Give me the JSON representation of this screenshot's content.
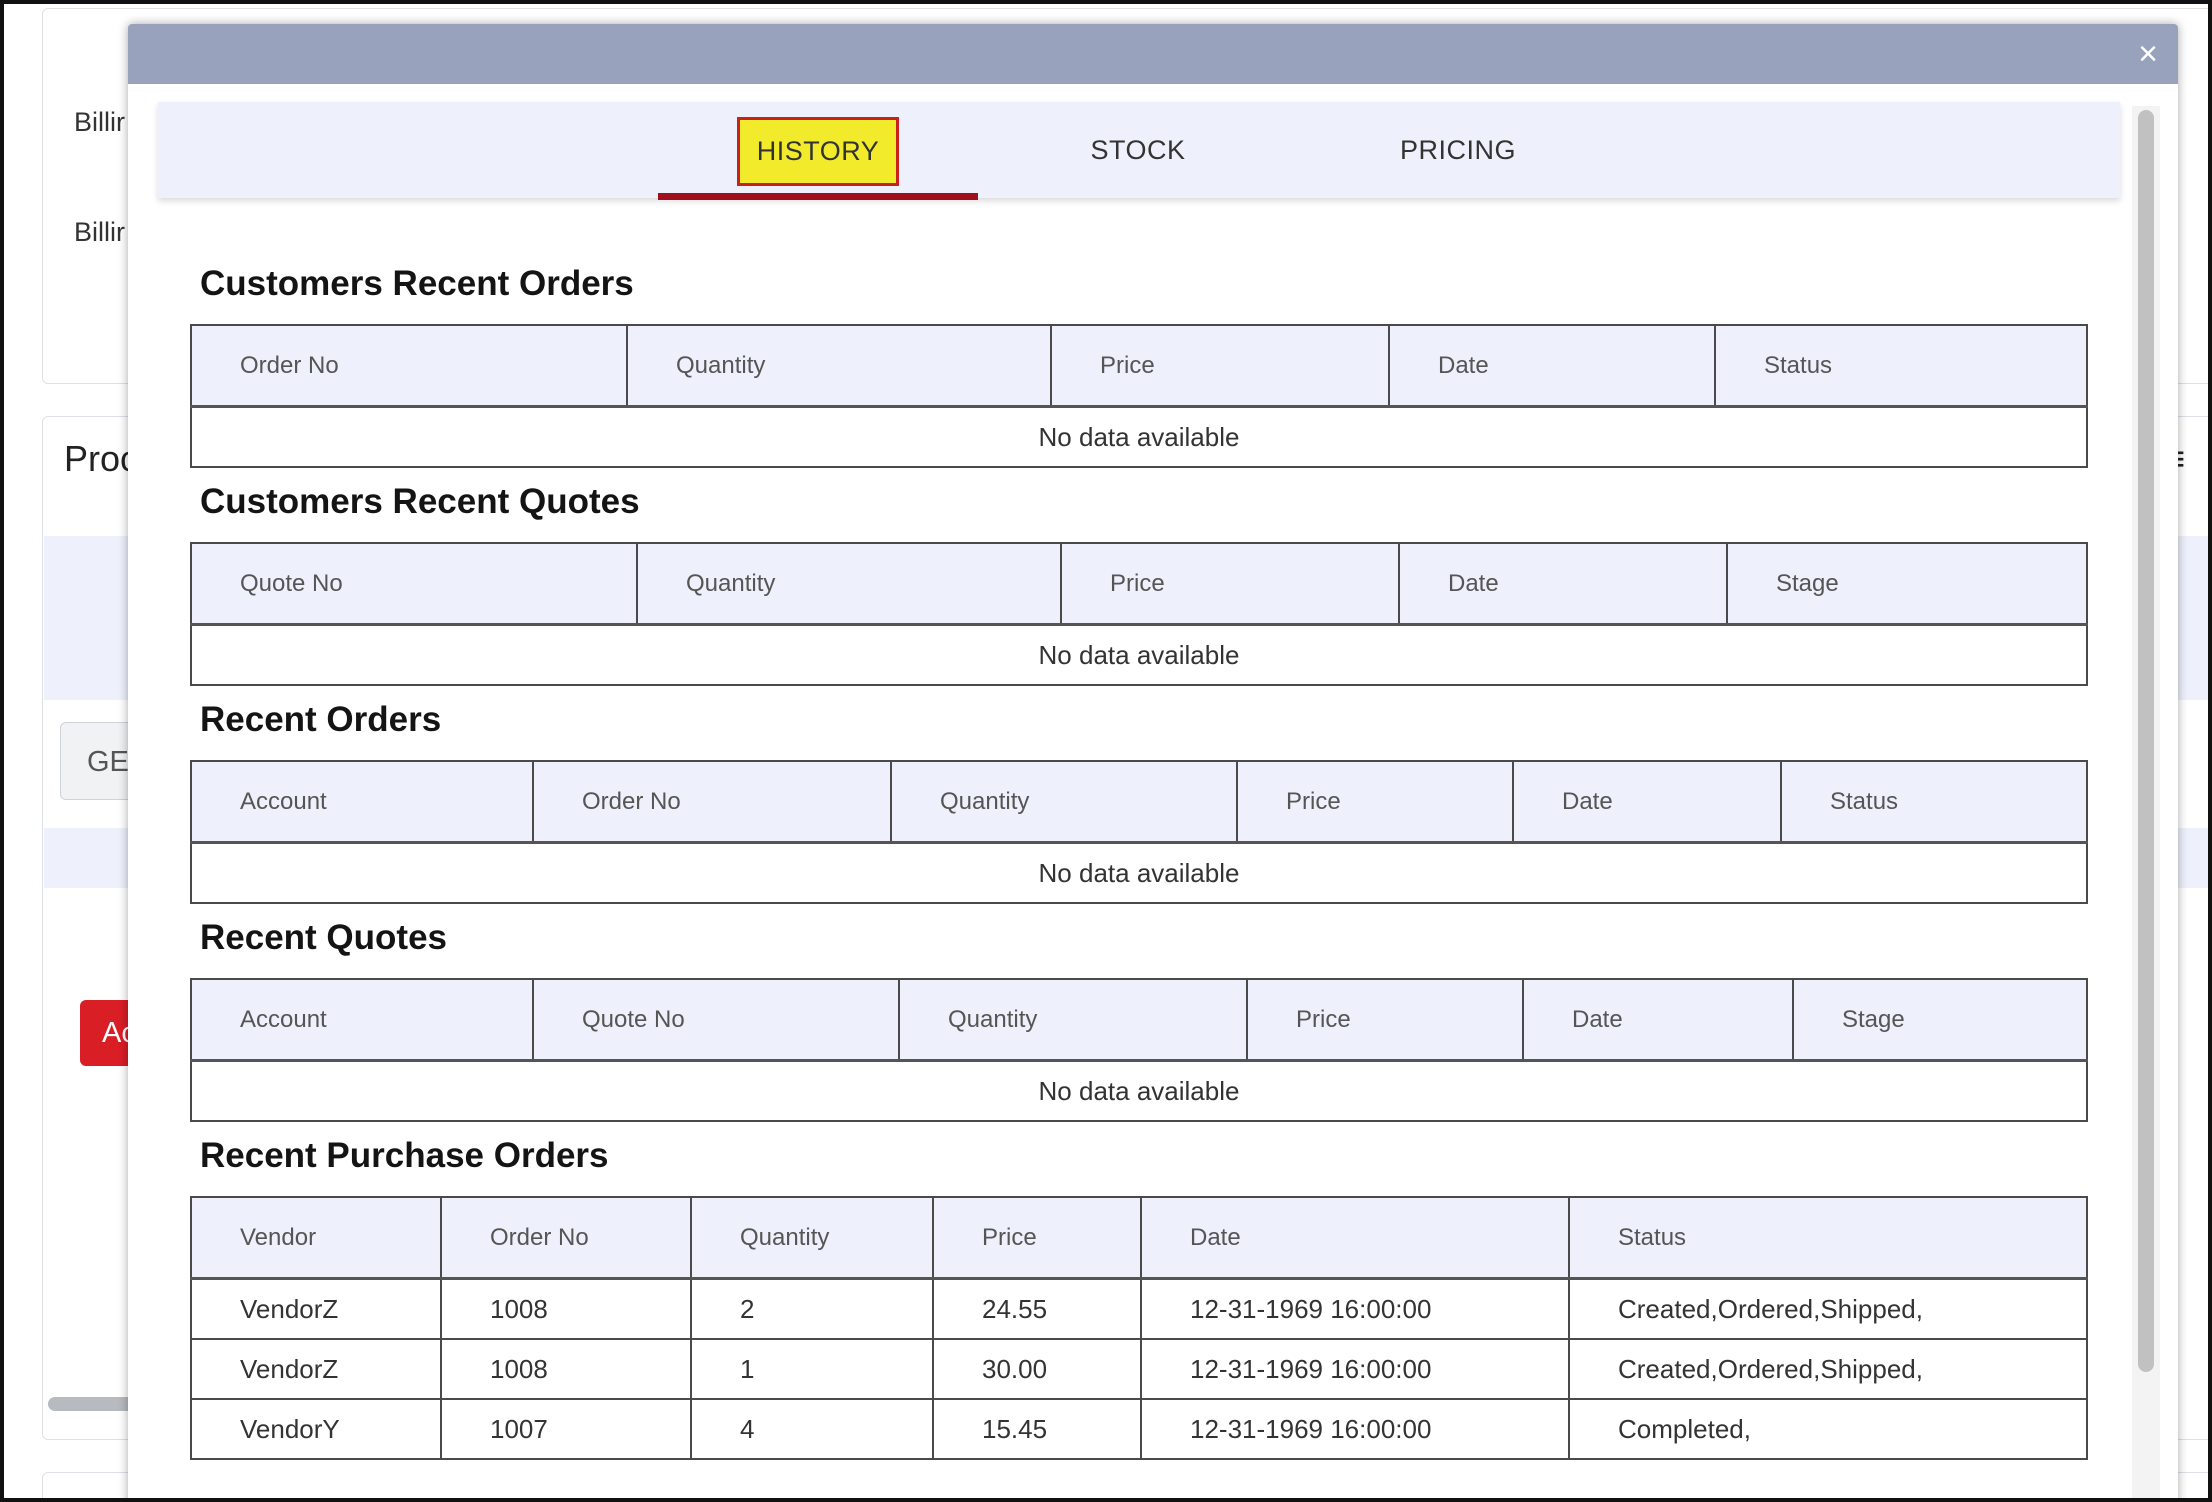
{
  "background": {
    "billing_label_1": "Billir",
    "billing_label_2": "Billir",
    "products_heading": "Proc",
    "gen_button": "GEI",
    "add_button": "Ac",
    "right_glyph": "≡"
  },
  "modal": {
    "close_label": "×",
    "tabs": [
      {
        "label": "HISTORY"
      },
      {
        "label": "STOCK"
      },
      {
        "label": "PRICING"
      }
    ],
    "empty_text": "No data available",
    "sections": {
      "customers_recent_orders": {
        "title": "Customers Recent Orders",
        "columns": [
          "Order No",
          "Quantity",
          "Price",
          "Date",
          "Status"
        ]
      },
      "customers_recent_quotes": {
        "title": "Customers Recent Quotes",
        "columns": [
          "Quote No",
          "Quantity",
          "Price",
          "Date",
          "Stage"
        ]
      },
      "recent_orders": {
        "title": "Recent Orders",
        "columns": [
          "Account",
          "Order No",
          "Quantity",
          "Price",
          "Date",
          "Status"
        ]
      },
      "recent_quotes": {
        "title": "Recent Quotes",
        "columns": [
          "Account",
          "Quote No",
          "Quantity",
          "Price",
          "Date",
          "Stage"
        ]
      },
      "recent_purchase_orders": {
        "title": "Recent Purchase Orders",
        "columns": [
          "Vendor",
          "Order No",
          "Quantity",
          "Price",
          "Date",
          "Status"
        ],
        "rows": [
          {
            "vendor": "VendorZ",
            "order_no": "1008",
            "quantity": "2",
            "price": "24.55",
            "date": "12-31-1969 16:00:00",
            "status": "Created,Ordered,Shipped,"
          },
          {
            "vendor": "VendorZ",
            "order_no": "1008",
            "quantity": "1",
            "price": "30.00",
            "date": "12-31-1969 16:00:00",
            "status": "Created,Ordered,Shipped,"
          },
          {
            "vendor": "VendorY",
            "order_no": "1007",
            "quantity": "4",
            "price": "15.45",
            "date": "12-31-1969 16:00:00",
            "status": "Completed,"
          }
        ]
      }
    }
  }
}
